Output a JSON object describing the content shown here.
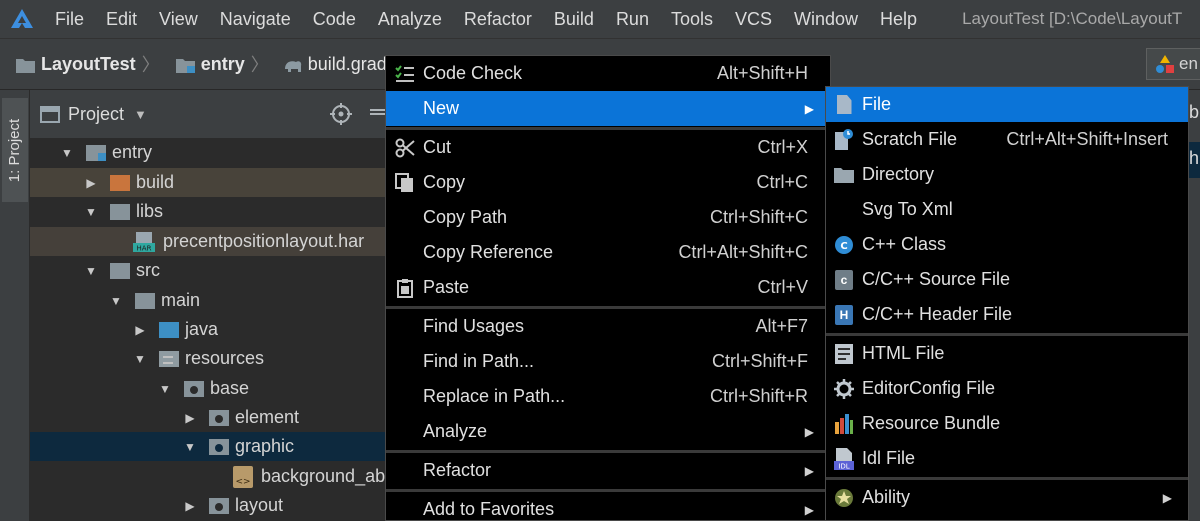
{
  "menubar": {
    "items": [
      "File",
      "Edit",
      "View",
      "Navigate",
      "Code",
      "Analyze",
      "Refactor",
      "Build",
      "Run",
      "Tools",
      "VCS",
      "Window",
      "Help"
    ],
    "window_title": "LayoutTest [D:\\Code\\LayoutT"
  },
  "navbar": {
    "crumbs": [
      "LayoutTest",
      "entry",
      "build.gradle"
    ],
    "run_config_fragment": "en"
  },
  "side_stripe": {
    "tab_label": "1: Project"
  },
  "project_panel": {
    "title": "Project",
    "tree": [
      {
        "label": "entry"
      },
      {
        "label": "build"
      },
      {
        "label": "libs"
      },
      {
        "label": "precentpositionlayout.har"
      },
      {
        "label": "src"
      },
      {
        "label": "main"
      },
      {
        "label": "java"
      },
      {
        "label": "resources"
      },
      {
        "label": "base"
      },
      {
        "label": "element"
      },
      {
        "label": "graphic"
      },
      {
        "label": "background_ab"
      },
      {
        "label": "layout"
      }
    ]
  },
  "context_menu": {
    "items": [
      {
        "label": "Code Check",
        "shortcut": "Alt+Shift+H",
        "icon": "code-check-icon"
      },
      {
        "label": "New",
        "shortcut": "",
        "icon": ""
      },
      {
        "label": "Cut",
        "shortcut": "Ctrl+X",
        "icon": "scissors-icon"
      },
      {
        "label": "Copy",
        "shortcut": "Ctrl+C",
        "icon": "copy-icon"
      },
      {
        "label": "Copy Path",
        "shortcut": "Ctrl+Shift+C",
        "icon": ""
      },
      {
        "label": "Copy Reference",
        "shortcut": "Ctrl+Alt+Shift+C",
        "icon": ""
      },
      {
        "label": "Paste",
        "shortcut": "Ctrl+V",
        "icon": "paste-icon"
      },
      {
        "label": "Find Usages",
        "shortcut": "Alt+F7",
        "icon": ""
      },
      {
        "label": "Find in Path...",
        "shortcut": "Ctrl+Shift+F",
        "icon": ""
      },
      {
        "label": "Replace in Path...",
        "shortcut": "Ctrl+Shift+R",
        "icon": ""
      },
      {
        "label": "Analyze",
        "shortcut": "",
        "icon": ""
      },
      {
        "label": "Refactor",
        "shortcut": "",
        "icon": ""
      },
      {
        "label": "Add to Favorites",
        "shortcut": "",
        "icon": ""
      }
    ]
  },
  "submenu_new": {
    "items": [
      {
        "label": "File",
        "shortcut": "",
        "icon": "file-icon"
      },
      {
        "label": "Scratch File",
        "shortcut": "Ctrl+Alt+Shift+Insert",
        "icon": "scratch-file-icon"
      },
      {
        "label": "Directory",
        "shortcut": "",
        "icon": "folder-icon"
      },
      {
        "label": "Svg To Xml",
        "shortcut": "",
        "icon": ""
      },
      {
        "label": "C++ Class",
        "shortcut": "",
        "icon": "cpp-class-icon"
      },
      {
        "label": "C/C++ Source File",
        "shortcut": "",
        "icon": "c-source-icon"
      },
      {
        "label": "C/C++ Header File",
        "shortcut": "",
        "icon": "c-header-icon"
      },
      {
        "label": "HTML File",
        "shortcut": "",
        "icon": "html-file-icon"
      },
      {
        "label": "EditorConfig File",
        "shortcut": "",
        "icon": "editorconfig-icon"
      },
      {
        "label": "Resource Bundle",
        "shortcut": "",
        "icon": "resource-bundle-icon"
      },
      {
        "label": "Idl File",
        "shortcut": "",
        "icon": "idl-file-icon"
      },
      {
        "label": "Ability",
        "shortcut": "",
        "icon": "ability-icon"
      }
    ]
  },
  "right_edge": {
    "frag1": "b",
    "frag2": "h"
  },
  "colors": {
    "menu_highlight": "#0b74d8",
    "tree_selection": "#0d293e",
    "background": "#2b2b2b"
  }
}
